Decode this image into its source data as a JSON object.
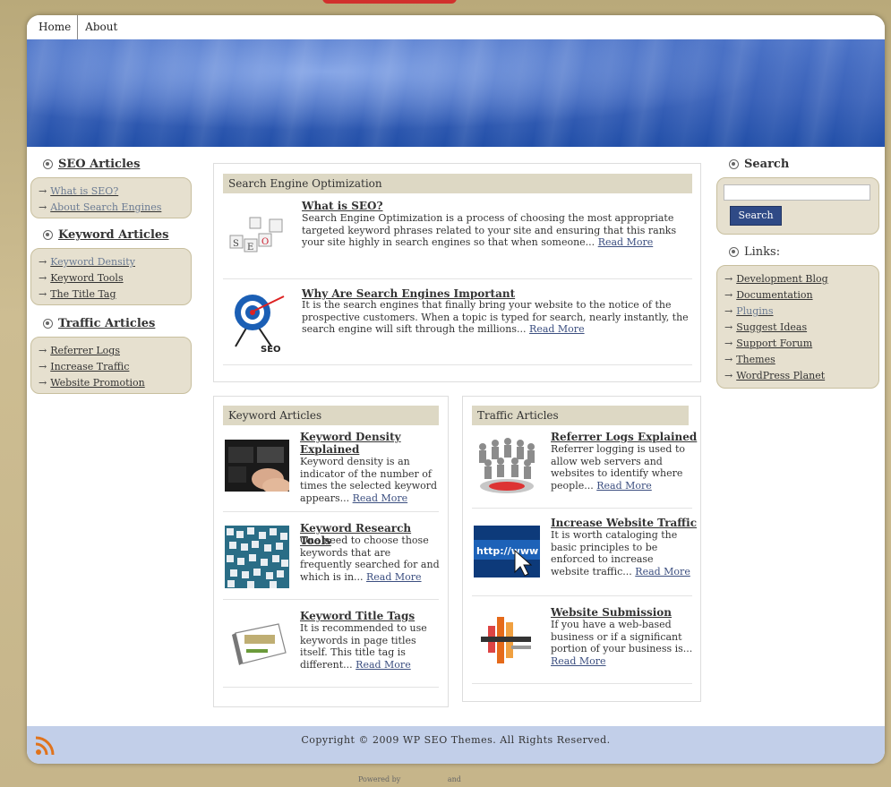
{
  "nav": {
    "items": [
      "Home",
      "About"
    ]
  },
  "left_sidebar": {
    "sections": [
      {
        "title": "SEO Articles",
        "links": [
          "What is SEO?",
          "About Search Engines"
        ]
      },
      {
        "title": "Keyword Articles",
        "links": [
          "Keyword Density",
          "Keyword Tools",
          "The Title Tag"
        ]
      },
      {
        "title": "Traffic Articles",
        "links": [
          "Referrer Logs",
          "Increase Traffic",
          "Website Promotion"
        ]
      }
    ]
  },
  "main": {
    "seo_panel": {
      "header": "Search Engine Optimization",
      "posts": [
        {
          "title": "What is SEO?",
          "excerpt": "Search Engine Optimization is a process of choosing the most appropriate targeted keyword phrases related to your site and ensuring that this ranks your site highly in search engines so that when someone...",
          "read_more": "Read More",
          "image_label": "SEO"
        },
        {
          "title": "Why Are Search Engines Important",
          "excerpt": "It is the search engines that finally bring your website to the notice of the prospective customers. When a topic is typed for search, nearly instantly, the search engine will sift through the millions...",
          "read_more": "Read More",
          "image_label": "SEO"
        }
      ]
    },
    "keyword_panel": {
      "header": "Keyword Articles",
      "posts": [
        {
          "title": "Keyword Density Explained",
          "excerpt": "Keyword density is an indicator of the number of times the selected keyword appears...",
          "read_more": "Read More"
        },
        {
          "title": "Keyword Research Tools",
          "excerpt": "One need to choose those keywords that are frequently searched for and which is in...",
          "read_more": "Read More"
        },
        {
          "title": "Keyword Title Tags",
          "excerpt": "It is recommended to use keywords in page titles itself. This title tag is different...",
          "read_more": "Read More"
        }
      ]
    },
    "traffic_panel": {
      "header": "Traffic Articles",
      "posts": [
        {
          "title": "Referrer Logs Explained",
          "excerpt": "Referrer logging is used to allow web servers and websites to identify where people...",
          "read_more": "Read More"
        },
        {
          "title": "Increase Website Traffic",
          "excerpt": "It is worth cataloging the basic principles to be enforced to increase website traffic...",
          "read_more": "Read More",
          "image_label": "http://www"
        },
        {
          "title": "Website Submission",
          "excerpt": "If you have a web-based business or if a significant portion of your business is...",
          "read_more": "Read More"
        }
      ]
    }
  },
  "right_sidebar": {
    "search_title": "Search",
    "search_button": "Search",
    "links_title": "Links:",
    "links": [
      "Development Blog",
      "Documentation",
      "Plugins",
      "Suggest Ideas",
      "Support Forum",
      "Themes",
      "WordPress Planet"
    ]
  },
  "footer": {
    "copyright": "Copyright © 2009 WP SEO Themes. All Rights Reserved.",
    "powered_by": "Powered by",
    "and": "and"
  },
  "colors": {
    "accent_blue": "#2f4a86",
    "banner_blue": "#3a62b9",
    "sidebar_box": "#e6e0cf",
    "panel_header": "#ddd8c4",
    "footer_bg": "#c2cfe9",
    "outer_bg": "#c6b58a"
  }
}
